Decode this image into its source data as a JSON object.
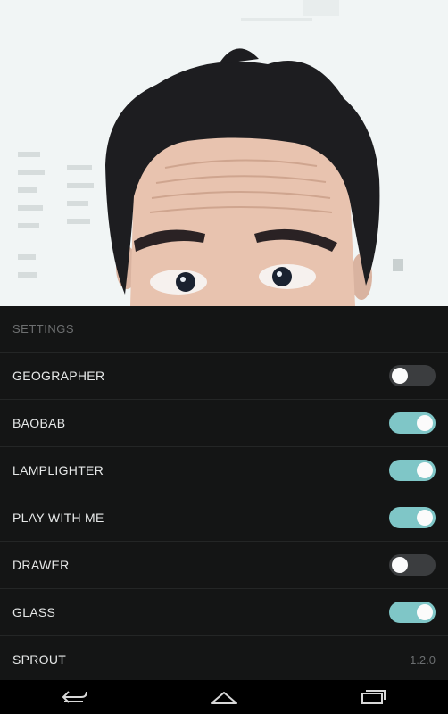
{
  "settings": {
    "header": "SETTINGS",
    "rows": [
      {
        "label": "GEOGRAPHER",
        "type": "toggle",
        "on": false
      },
      {
        "label": "BAOBAB",
        "type": "toggle",
        "on": true
      },
      {
        "label": "LAMPLIGHTER",
        "type": "toggle",
        "on": true
      },
      {
        "label": "PLAY WITH ME",
        "type": "toggle",
        "on": true
      },
      {
        "label": "DRAWER",
        "type": "toggle",
        "on": false
      },
      {
        "label": "GLASS",
        "type": "toggle",
        "on": true
      },
      {
        "label": "SPROUT",
        "type": "value",
        "value": "1.2.0"
      }
    ]
  },
  "navbar": {
    "back_icon": "back-icon",
    "home_icon": "home-icon",
    "recents_icon": "recent-apps-icon"
  },
  "colors": {
    "toggle_on": "#7fc6c7",
    "toggle_off": "#3b3d3f",
    "background": "#141515"
  }
}
